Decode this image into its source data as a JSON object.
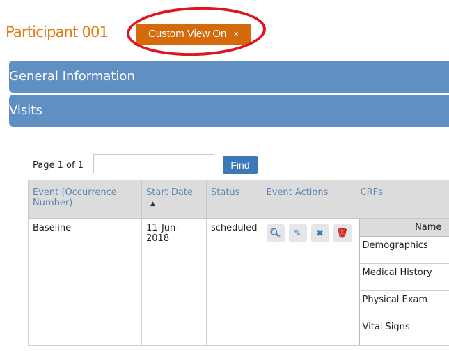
{
  "header": {
    "title": "Participant 001",
    "custom_view_label": "Custom View On",
    "custom_view_close": "×"
  },
  "panels": {
    "general_information": "General Information",
    "visits": "Visits"
  },
  "pager": {
    "page_text": "Page 1 of 1",
    "find_label": "Find",
    "input_value": ""
  },
  "table": {
    "headers": {
      "event": "Event (Occurrence Number)",
      "start_date": "Start Date",
      "status": "Status",
      "event_actions": "Event Actions",
      "crfs": "CRFs"
    },
    "rows": [
      {
        "event": "Baseline",
        "start_date": "11-Jun-2018",
        "status": "scheduled",
        "crf_header": "Name",
        "crfs": [
          "Demographics",
          "Medical History",
          "Physical Exam",
          "Vital Signs"
        ]
      }
    ]
  },
  "colors": {
    "title_orange": "#e07a10",
    "button_orange": "#d46a0c",
    "panel_blue": "#5f8fc3",
    "find_blue": "#3c79b8",
    "annotation_red": "#e0141e"
  },
  "icons": [
    "magnifier-icon",
    "pencil-icon",
    "x-icon",
    "trash-icon"
  ]
}
